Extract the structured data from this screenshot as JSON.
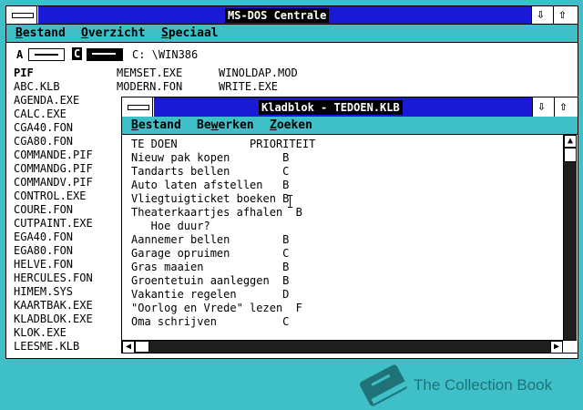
{
  "msdos": {
    "title": "MS-DOS Centrale",
    "menu": [
      {
        "first": "B",
        "rest": "estand"
      },
      {
        "first": "O",
        "rest": "verzicht"
      },
      {
        "first": "S",
        "rest": "peciaal"
      }
    ],
    "drives": {
      "a_label": "A",
      "c_label": "C",
      "path": "C: \\WIN386"
    },
    "files_col1": [
      "PIF",
      "ABC.KLB",
      "AGENDA.EXE",
      "CALC.EXE",
      "CGA40.FON",
      "CGA80.FON",
      "COMMANDE.PIF",
      "COMMANDG.PIF",
      "COMMANDV.PIF",
      "CONTROL.EXE",
      "COURE.FON",
      "CUTPAINT.EXE",
      "EGA40.FON",
      "EGA80.FON",
      "HELVE.FON",
      "HERCULES.FON",
      "HIMEM.SYS",
      "KAARTBAK.EXE",
      "KLADBLOK.EXE",
      "KLOK.EXE",
      "LEESME.KLB"
    ],
    "files_col2": [
      "MEMSET.EXE",
      "MODERN.FON"
    ],
    "files_col3": [
      "WINOLDAP.MOD",
      "WRITE.EXE"
    ]
  },
  "notepad": {
    "title": "Kladblok - TEDOEN.KLB",
    "menu": [
      {
        "pre": "",
        "ul": "B",
        "post": "estand"
      },
      {
        "pre": "Be",
        "ul": "w",
        "post": "erken"
      },
      {
        "pre": "",
        "ul": "Z",
        "post": "oeken"
      }
    ],
    "lines": [
      "TE DOEN           PRIORITEIT",
      "Nieuw pak kopen        B",
      "Tandarts bellen        C",
      "Auto laten afstellen   B",
      "Vliegtuigticket boeken B",
      "Theaterkaartjes afhalen  B",
      "   Hoe duur?",
      "Aannemer bellen        B",
      "Garage opruimen        C",
      "Gras maaien            B",
      "Groentetuin aanleggen  B",
      "Vakantie regelen       D",
      "\"Oorlog en Vrede\" lezen  F",
      "Oma schrijven          C"
    ]
  },
  "watermark": "The Collection Book"
}
